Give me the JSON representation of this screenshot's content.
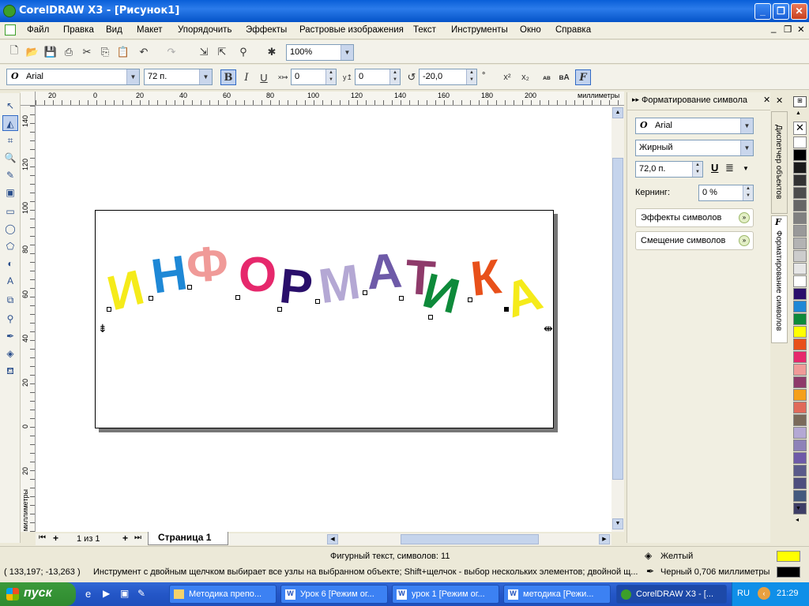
{
  "window": {
    "title": "CorelDRAW X3 - [Рисунок1]"
  },
  "menu": [
    "Файл",
    "Правка",
    "Вид",
    "Макет",
    "Упорядочить",
    "Эффекты",
    "Растровые изображения",
    "Текст",
    "Инструменты",
    "Окно",
    "Справка"
  ],
  "toolbar": {
    "zoom": "100%"
  },
  "propbar": {
    "font": "Arial",
    "size": "72 п.",
    "offset1": "0",
    "offset2": "0",
    "rotation": "-20,0",
    "degree": "°"
  },
  "ruler": {
    "units": "миллиметры",
    "h_ticks": [
      "20",
      "0",
      "20",
      "40",
      "60",
      "80",
      "100",
      "120",
      "140",
      "160",
      "180",
      "200"
    ],
    "v_ticks": [
      "140",
      "120",
      "100",
      "80",
      "60",
      "40",
      "20",
      "0",
      "20"
    ]
  },
  "artwork": {
    "letters": [
      {
        "ch": "И",
        "color": "#F5EB1A"
      },
      {
        "ch": "Н",
        "color": "#1E88D6"
      },
      {
        "ch": "Ф",
        "color": "#F09A98"
      },
      {
        "ch": "О",
        "color": "#E6286C"
      },
      {
        "ch": "Р",
        "color": "#2A0F6B"
      },
      {
        "ch": "М",
        "color": "#B4A8D4"
      },
      {
        "ch": "А",
        "color": "#6E5AA8"
      },
      {
        "ch": "Т",
        "color": "#8E3A6A"
      },
      {
        "ch": "И",
        "color": "#0E8A3A"
      },
      {
        "ch": "К",
        "color": "#E8501A"
      },
      {
        "ch": "А",
        "color": "#F5EB1A"
      }
    ]
  },
  "pages": {
    "counter": "1 из 1",
    "tab": "Страница 1"
  },
  "docker": {
    "title": "Форматирование символа",
    "font": "Arial",
    "style": "Жирный",
    "size": "72,0 п.",
    "kerning_label": "Кернинг:",
    "kerning_value": "0 %",
    "section1": "Эффекты символов",
    "section2": "Смещение символов",
    "tab1": "Диспетчер объектов",
    "tab2": "Форматирование символов"
  },
  "status": {
    "object": "Фигурный текст, символов: 11",
    "coords": "( 133,197; -13,263 )",
    "hint": "Инструмент с двойным щелчком выбирает все узлы на выбранном объекте; Shift+щелчок - выбор нескольких элементов; двойной щ...",
    "fill_name": "Желтый",
    "fill_color": "#FFFF00",
    "outline": "Черный  0,706 миллиметры",
    "outline_color": "#000000"
  },
  "taskbar": {
    "start": "пуск",
    "tasks": [
      "Методика препо...",
      "Урок 6 [Режим ог...",
      "урок 1 [Режим ог...",
      "методика [Режи...",
      "CorelDRAW X3 - [..."
    ],
    "lang": "RU",
    "time": "21:29"
  },
  "palette": [
    "#FFFFFF",
    "#000000",
    "#1A1A1A",
    "#333333",
    "#4D4D4D",
    "#666666",
    "#808080",
    "#999999",
    "#B3B3B3",
    "#CCCCCC",
    "#E6E6E6",
    "#FFFFFF",
    "#2A0F6B",
    "#1E88D6",
    "#0E8A3A",
    "#FFFF00",
    "#E8501A",
    "#E6286C",
    "#F09A98",
    "#8E3A6A",
    "#F5A01A",
    "#E06A5A",
    "#7A6A5A",
    "#B4A8D4",
    "#8E82B8",
    "#6E5AA8",
    "#5A5A8A",
    "#4E4E7E",
    "#445A7E",
    "#3E3E66"
  ]
}
